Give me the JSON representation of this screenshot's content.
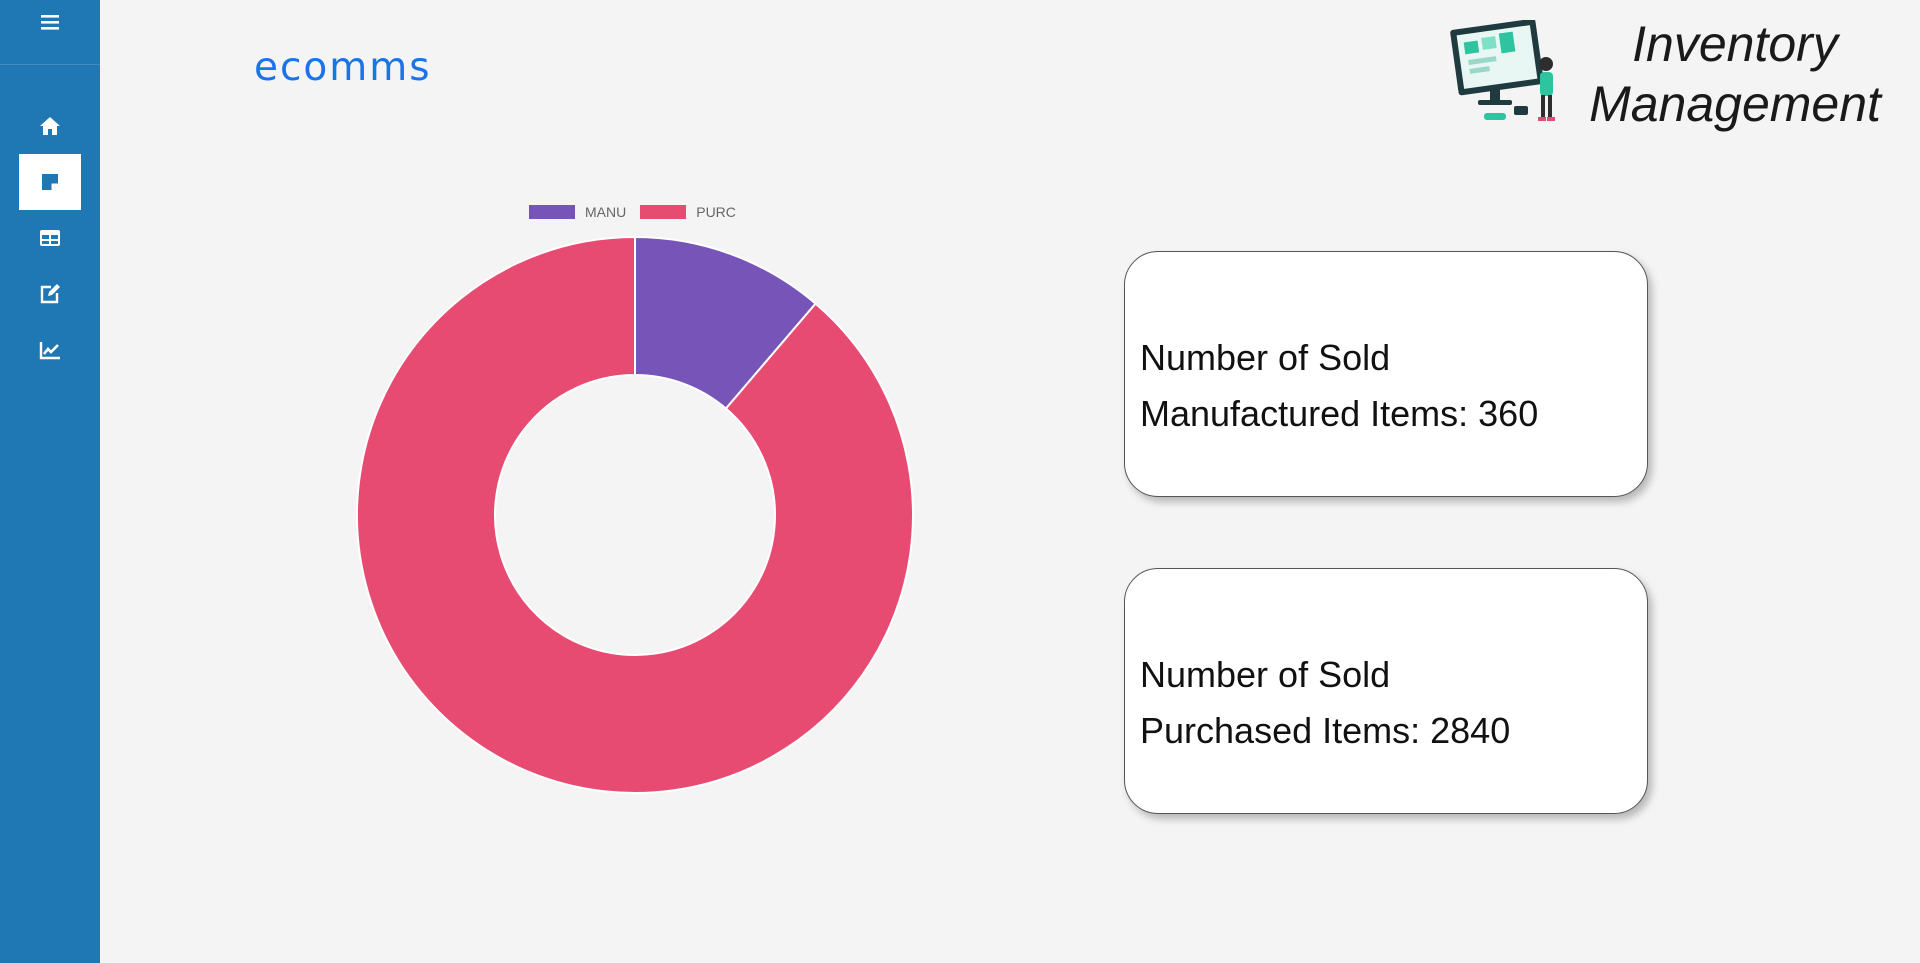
{
  "brand": {
    "name": "ecomms"
  },
  "header": {
    "title_line1": "Inventory",
    "title_line2": "Management"
  },
  "sidebar": {
    "toggle_icon": "hamburger-menu-icon",
    "items": [
      {
        "icon": "home-icon",
        "active": false
      },
      {
        "icon": "sticky-note-icon",
        "active": true
      },
      {
        "icon": "table-icon",
        "active": false
      },
      {
        "icon": "edit-icon",
        "active": false
      },
      {
        "icon": "chart-line-icon",
        "active": false
      }
    ]
  },
  "colors": {
    "sidebar": "#1f77b4",
    "brand_text": "#1a73e8",
    "manu": "#7654b8",
    "purc": "#e84b72",
    "background": "#f4f4f4"
  },
  "chart_data": {
    "type": "pie",
    "donut": true,
    "labels": [
      "MANU",
      "PURC"
    ],
    "values": [
      360,
      2840
    ],
    "colors": [
      "#7654b8",
      "#e84b72"
    ],
    "legend_position": "top"
  },
  "cards": {
    "manufactured": {
      "line1": "Number of Sold",
      "line2": "Manufactured Items: 360"
    },
    "purchased": {
      "line1": "Number of Sold",
      "line2": "Purchased Items: 2840"
    }
  }
}
